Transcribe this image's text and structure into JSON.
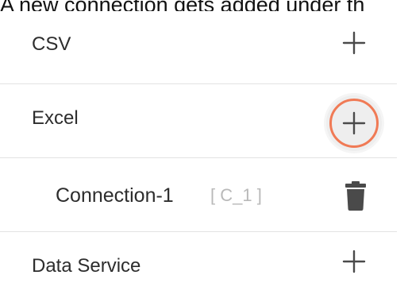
{
  "caption": {
    "text": "A new connection gets added under th"
  },
  "connections_panel": {
    "items": [
      {
        "label": "CSV",
        "action_icon": "plus-icon"
      },
      {
        "label": "Excel",
        "action_icon": "plus-icon",
        "highlighted": true
      },
      {
        "label": "Connection-1",
        "code": "[ C_1 ]",
        "action_icon": "trash-icon"
      },
      {
        "label": "Data Service",
        "action_icon": "plus-icon"
      }
    ]
  },
  "colors": {
    "highlight_ring": "#f07a55",
    "text": "#2d2d2d",
    "muted_code": "#b9b9b9",
    "divider": "#e3e3e3",
    "icon": "#4a4a4a"
  }
}
